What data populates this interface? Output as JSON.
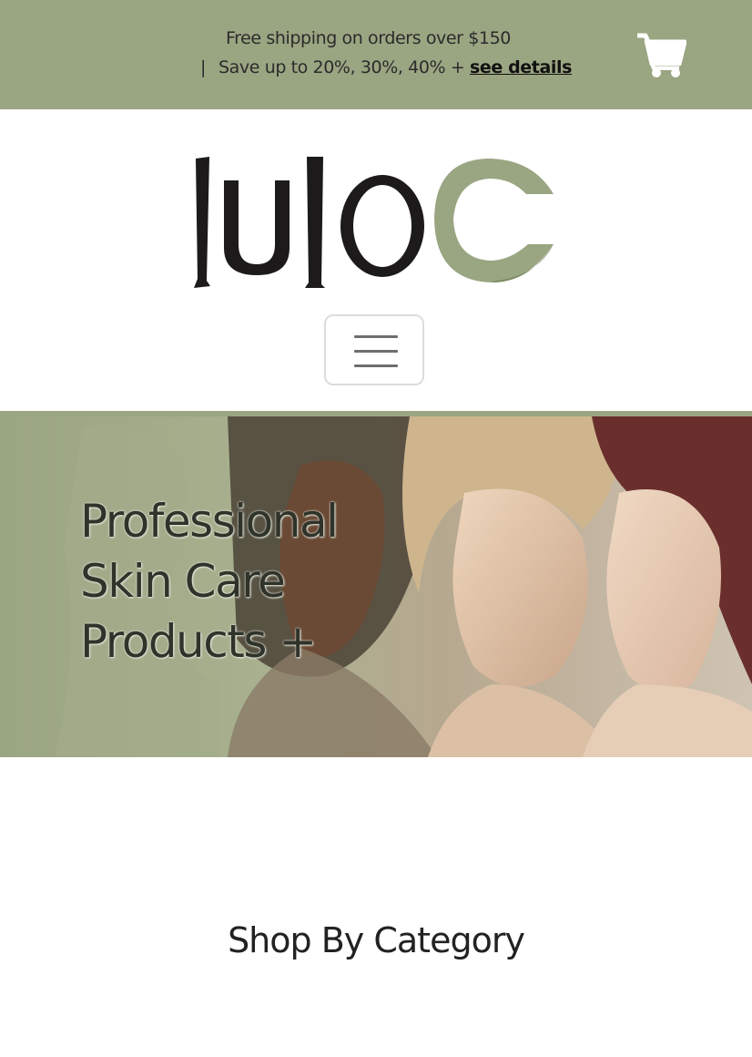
{
  "promo": {
    "line1": "Free shipping on orders over $150",
    "separator": "|",
    "line2_text": "Save up to 20%, 30%, 40% + ",
    "details_link": "see details"
  },
  "header": {
    "logo_text": "luloC",
    "cart_icon": "shopping-cart-icon",
    "menu_icon": "hamburger-menu-icon"
  },
  "hero": {
    "title_lines": [
      "Professional",
      "Skin Care",
      "Products +"
    ]
  },
  "sections": {
    "shop_by_category": "Shop By Category"
  },
  "colors": {
    "brand_green": "#9aa582",
    "text_dark": "#222222"
  }
}
